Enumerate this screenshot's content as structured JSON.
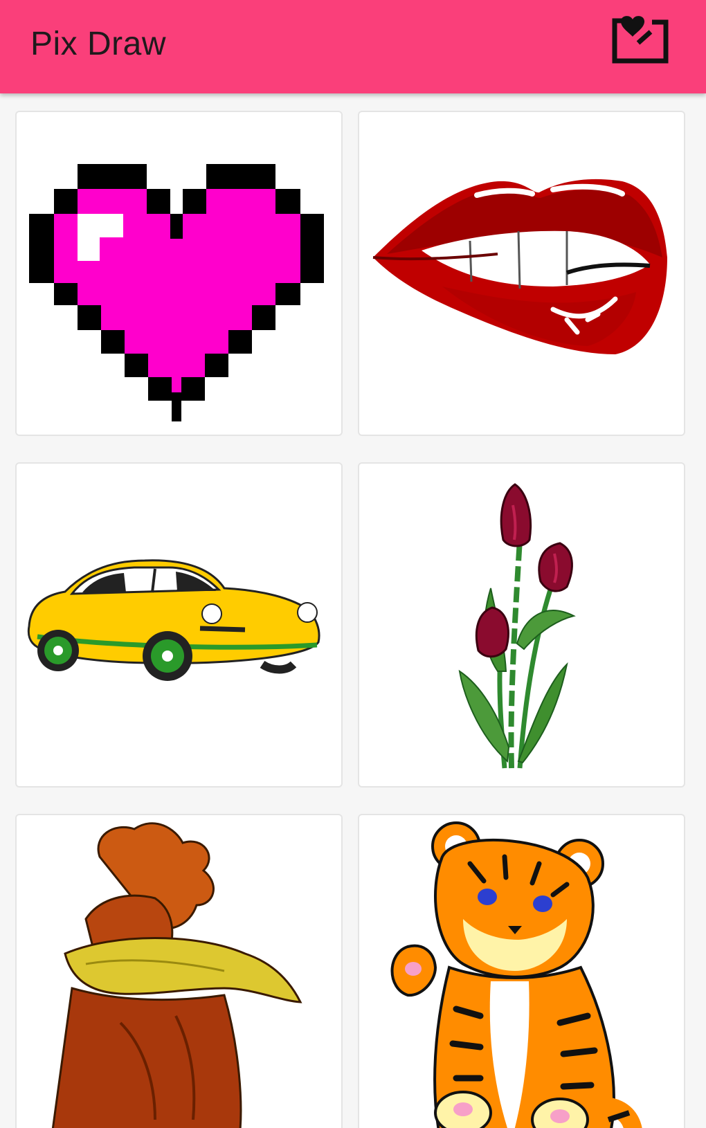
{
  "app": {
    "title": "Pix Draw",
    "accent_color": "#fa3f7a",
    "favorites_icon": "heart-import-icon"
  },
  "gallery": {
    "items": [
      {
        "subject": "heart",
        "icon": "pixel-heart-image"
      },
      {
        "subject": "lips",
        "icon": "lips-image"
      },
      {
        "subject": "car",
        "icon": "yellow-car-image"
      },
      {
        "subject": "tulips",
        "icon": "tulips-image"
      },
      {
        "subject": "rooster",
        "icon": "rooster-image"
      },
      {
        "subject": "tiger",
        "icon": "tiger-cub-image"
      }
    ]
  }
}
